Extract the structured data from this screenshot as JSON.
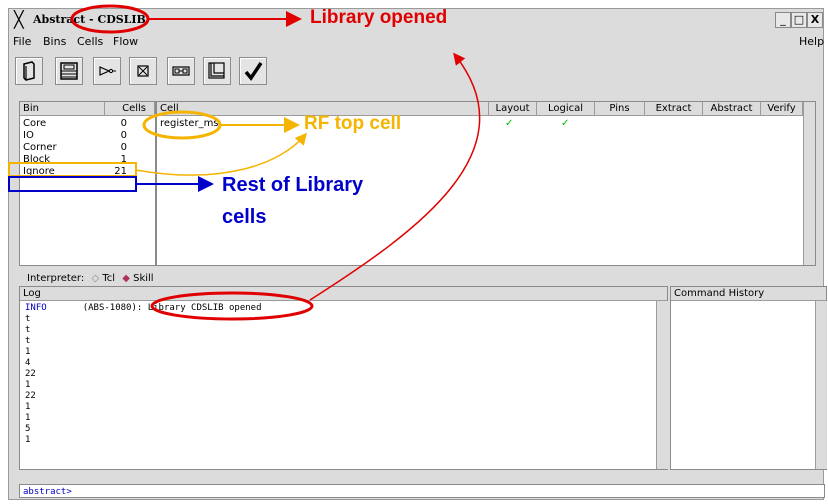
{
  "window": {
    "title_prefix": "Abstract",
    "title_suffix": "- CDSLIB",
    "buttons": [
      "_",
      "□",
      "X"
    ]
  },
  "menu": {
    "items": [
      "File",
      "Bins",
      "Cells",
      "Flow"
    ],
    "help": "Help"
  },
  "toolbar": {
    "tools": [
      "library-book-icon",
      "bin-grid-icon",
      "flow-arrow-icon",
      "cross-box-icon",
      "cell-blocks-icon",
      "layout-icon",
      "checkmark-icon"
    ]
  },
  "bins": {
    "headers": [
      "Bin",
      "Cells"
    ],
    "rows": [
      {
        "name": "Core",
        "count": "0"
      },
      {
        "name": "IO",
        "count": "0"
      },
      {
        "name": "Corner",
        "count": "0"
      },
      {
        "name": "Block",
        "count": "1"
      },
      {
        "name": "Ignore",
        "count": "21"
      }
    ]
  },
  "cells": {
    "headers": [
      "Cell",
      "Layout",
      "Logical",
      "Pins",
      "Extract",
      "Abstract",
      "Verify"
    ],
    "rows": [
      {
        "name": "register_ms",
        "layout": "✓",
        "logical": "✓"
      }
    ]
  },
  "interpreter": {
    "label": "Interpreter:",
    "options": [
      "Tcl",
      "Skill"
    ],
    "selected": "Skill"
  },
  "log": {
    "header": "Log",
    "lines": [
      {
        "level": "INFO",
        "text": "(ABS-1080): Library CDSLIB opened"
      },
      {
        "level": "",
        "text": "t"
      },
      {
        "level": "",
        "text": "t"
      },
      {
        "level": "",
        "text": "t"
      },
      {
        "level": "",
        "text": "1"
      },
      {
        "level": "",
        "text": "4"
      },
      {
        "level": "",
        "text": "22"
      },
      {
        "level": "",
        "text": "1"
      },
      {
        "level": "",
        "text": "22"
      },
      {
        "level": "",
        "text": "1"
      },
      {
        "level": "",
        "text": "1"
      },
      {
        "level": "",
        "text": "5"
      },
      {
        "level": "",
        "text": "1"
      }
    ]
  },
  "history": {
    "header": "Command History"
  },
  "command": {
    "prompt": "abstract>"
  },
  "annotations": {
    "library_opened": "Library opened",
    "rf_top_cell": "RF top cell",
    "rest_line1": "Rest of Library",
    "rest_line2": "cells"
  },
  "colors": {
    "red": "#e00000",
    "orange": "#f5b400",
    "blue": "#0000cc",
    "check": "#00b000",
    "info": "#0000c0"
  }
}
